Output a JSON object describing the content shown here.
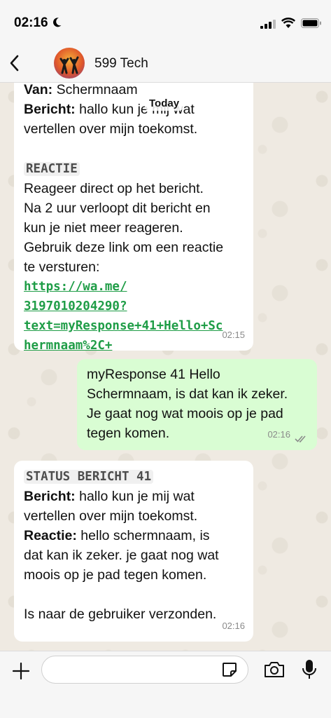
{
  "status_bar": {
    "time": "02:16"
  },
  "header": {
    "contact_name": "599 Tech"
  },
  "date_label": "Today",
  "messages": [
    {
      "from_label": "Van:",
      "from_value": " Schermnaam",
      "bericht_label": "Bericht:",
      "bericht_value": " hallo kun je mij wat",
      "bericht_line2": "vertellen over mijn toekomst.",
      "section_title": "REACTIE",
      "body_lines": [
        "Reageer direct op het bericht.",
        "Na 2 uur verloopt dit bericht en",
        "kun je niet meer reageren.",
        "Gebruik deze link om een reactie",
        "te versturen:"
      ],
      "link_lines": [
        "https://wa.me/",
        "3197010204290?",
        "text=myResponse+41+Hello+Sc",
        "hermnaam%2C+"
      ],
      "time": "02:15"
    },
    {
      "lines": [
        "myResponse 41 Hello",
        "Schermnaam, is dat kan ik zeker.",
        "Je gaat nog wat moois op je pad",
        "tegen komen."
      ],
      "time": "02:16"
    },
    {
      "title": "STATUS BERICHT 41",
      "bericht_label": "Bericht:",
      "bericht_value": " hallo kun je mij wat",
      "bericht_line2": "vertellen over mijn toekomst.",
      "reactie_label": "Reactie:",
      "reactie_value": " hello schermnaam, is",
      "reactie_lines": [
        "dat kan ik zeker. je gaat nog wat",
        "moois op je pad tegen komen."
      ],
      "footer": "Is naar de gebruiker verzonden.",
      "time": "02:16"
    }
  ],
  "colors": {
    "outgoing": "#d9fdd3",
    "incoming": "#ffffff",
    "link": "#1f9d47",
    "read_ticks": "#8a8a8a"
  },
  "icons": [
    "moon-icon",
    "signal-icon",
    "wifi-icon",
    "battery-icon",
    "back-icon",
    "plus-icon",
    "sticker-icon",
    "camera-icon",
    "mic-icon",
    "read-ticks-icon"
  ]
}
